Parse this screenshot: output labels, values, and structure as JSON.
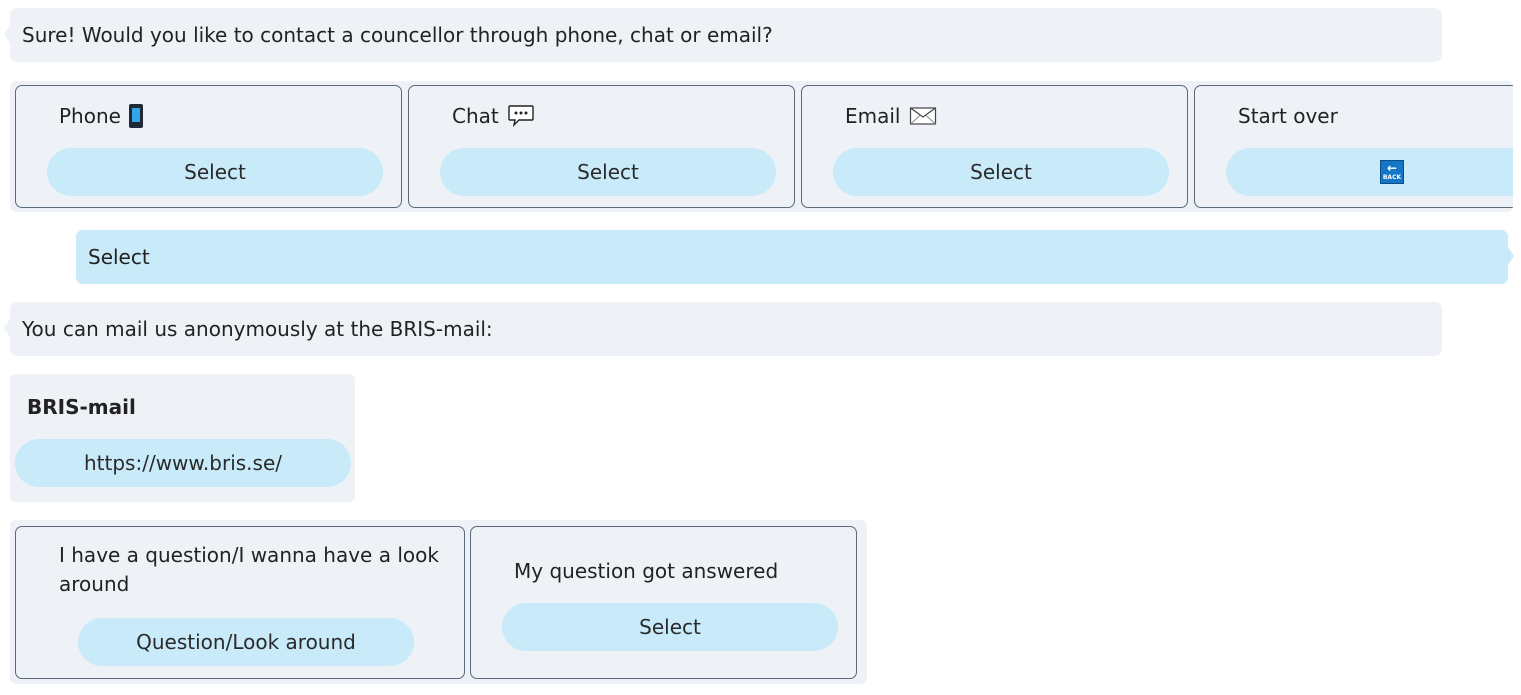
{
  "messages": {
    "bot1": "Sure! Would you like to contact a councellor through phone, chat or email?",
    "user1": "Select",
    "bot2": "You can mail us anonymously at the BRIS-mail:"
  },
  "contact_cards": [
    {
      "title": "Phone",
      "icon": "mobile-phone-icon",
      "button": "Select"
    },
    {
      "title": "Chat",
      "icon": "speech-bubble-icon",
      "button": "Select"
    },
    {
      "title": "Email",
      "icon": "envelope-icon",
      "button": "Select"
    },
    {
      "title": "Start over",
      "icon": "back-arrow-icon",
      "button_icon_text": "BACK"
    }
  ],
  "bris_card": {
    "title": "BRIS-mail",
    "link": "https://www.bris.se/"
  },
  "followup_cards": [
    {
      "title": "I have a question/I wanna have a look around",
      "button": "Question/Look around"
    },
    {
      "title": "My question got answered",
      "button": "Select"
    }
  ],
  "colors": {
    "bubble_bg": "#eef2f7",
    "pill_bg": "#c8eaf9",
    "card_border": "#5a6a7a"
  }
}
